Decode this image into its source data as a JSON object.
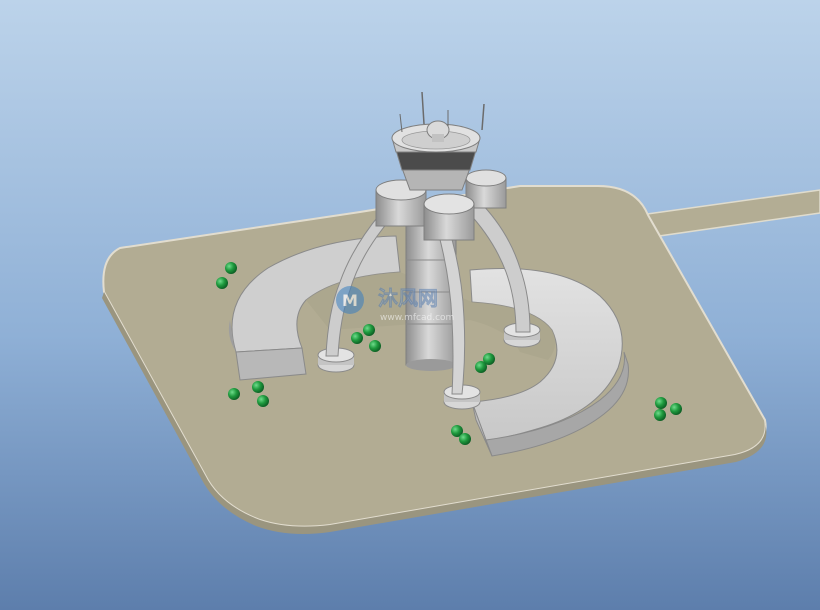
{
  "viewport": {
    "background_top": "#b9d2ea",
    "background_bottom": "#5f7fad"
  },
  "model": {
    "ground_color": "#b3ad94",
    "ground_edge_color": "#d8d4c4",
    "structure_color": "#d6d6d6",
    "structure_shadow": "#8a8a8a",
    "tree_color": "#1f9a3e"
  },
  "watermark": {
    "brand_cn": "沐风网",
    "site": "www.mfcad.com",
    "logo_letter": "M"
  }
}
